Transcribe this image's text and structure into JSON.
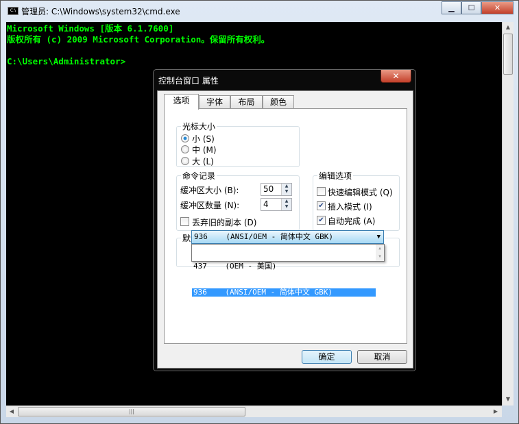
{
  "window": {
    "title": "管理员: C:\\Windows\\system32\\cmd.exe",
    "icon": "cmd-icon",
    "controls": [
      "minimize",
      "maximize",
      "close"
    ]
  },
  "console": {
    "lines": [
      "Microsoft Windows [版本 6.1.7600]",
      "版权所有 (c) 2009 Microsoft Corporation。保留所有权利。",
      "",
      "C:\\Users\\Administrator>"
    ],
    "text_color": "#00ff00"
  },
  "dialog": {
    "title": "控制台窗口 属性",
    "tabs": [
      {
        "label": "选项",
        "selected": true
      },
      {
        "label": "字体"
      },
      {
        "label": "布局"
      },
      {
        "label": "颜色"
      }
    ],
    "cursor_size": {
      "label": "光标大小",
      "options": [
        {
          "label": "小 (S)",
          "checked": true
        },
        {
          "label": "中 (M)"
        },
        {
          "label": "大 (L)"
        }
      ]
    },
    "history": {
      "label": "命令记录",
      "buffer_size_label": "缓冲区大小 (B):",
      "buffer_size": "50",
      "buffer_count_label": "缓冲区数量 (N):",
      "buffer_count": "4",
      "discard_label": "丢弃旧的副本 (D)",
      "discard_checked": false
    },
    "edit_options": {
      "label": "编辑选项",
      "items": [
        {
          "label": "快速编辑模式 (Q)",
          "checked": false
        },
        {
          "label": "插入模式 (I)",
          "checked": true
        },
        {
          "label": "自动完成 (A)",
          "checked": true
        }
      ]
    },
    "codepage": {
      "label": "默认代码页",
      "selected": "936    (ANSI/OEM - 简体中文 GBK)",
      "options": [
        "437    (OEM - 美国)",
        "936    (ANSI/OEM - 简体中文 GBK)"
      ],
      "highlighted_index": 1
    },
    "ok": "确定",
    "cancel": "取消"
  }
}
